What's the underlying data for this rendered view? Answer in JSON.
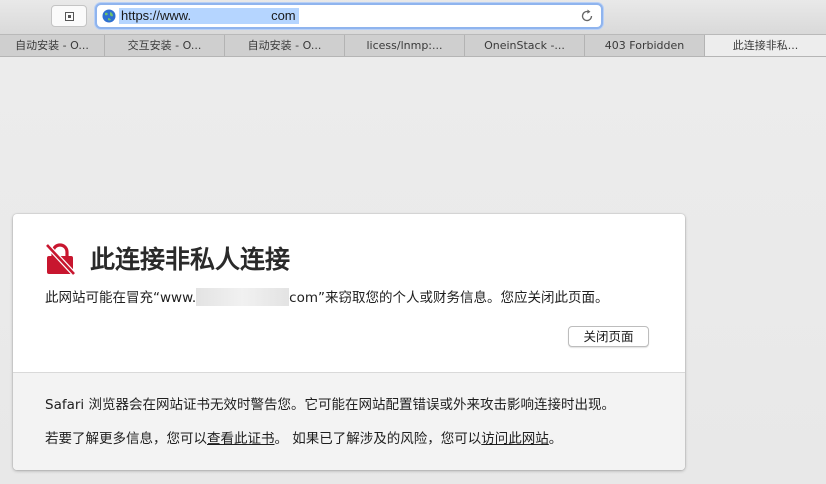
{
  "toolbar": {
    "sidebar_icon": "sidebar-icon",
    "url_prefix": "https://www.",
    "url_suffix": "com",
    "reload_icon": "reload-icon"
  },
  "tabs": [
    {
      "label": "自动安装 - O...",
      "active": false
    },
    {
      "label": "交互安装 - O...",
      "active": false
    },
    {
      "label": "自动安装 - O...",
      "active": false
    },
    {
      "label": "licess/lnmp:...",
      "active": false
    },
    {
      "label": "OneinStack -...",
      "active": false
    },
    {
      "label": "403 Forbidden",
      "active": false
    },
    {
      "label": "此连接非私...",
      "active": true
    }
  ],
  "warning": {
    "icon": "not-private-lock-icon",
    "title": "此连接非私人连接",
    "message_prefix": "此网站可能在冒充“www.",
    "message_suffix": "com”来窃取您的个人或财务信息。您应关闭此页面。",
    "close_button": "关闭页面"
  },
  "footer": {
    "line1": "Safari 浏览器会在网站证书无效时警告您。它可能在网站配置错误或外来攻击影响连接时出现。",
    "line2_part1": "若要了解更多信息，您可以",
    "line2_link1": "查看此证书",
    "line2_part2": "。 如果已了解涉及的风险，您可以",
    "line2_link2": "访问此网站",
    "line2_part3": "。"
  },
  "colors": {
    "warning_red": "#c8162f",
    "url_focus": "#8fb4ee",
    "selection": "#b5d5ff"
  }
}
